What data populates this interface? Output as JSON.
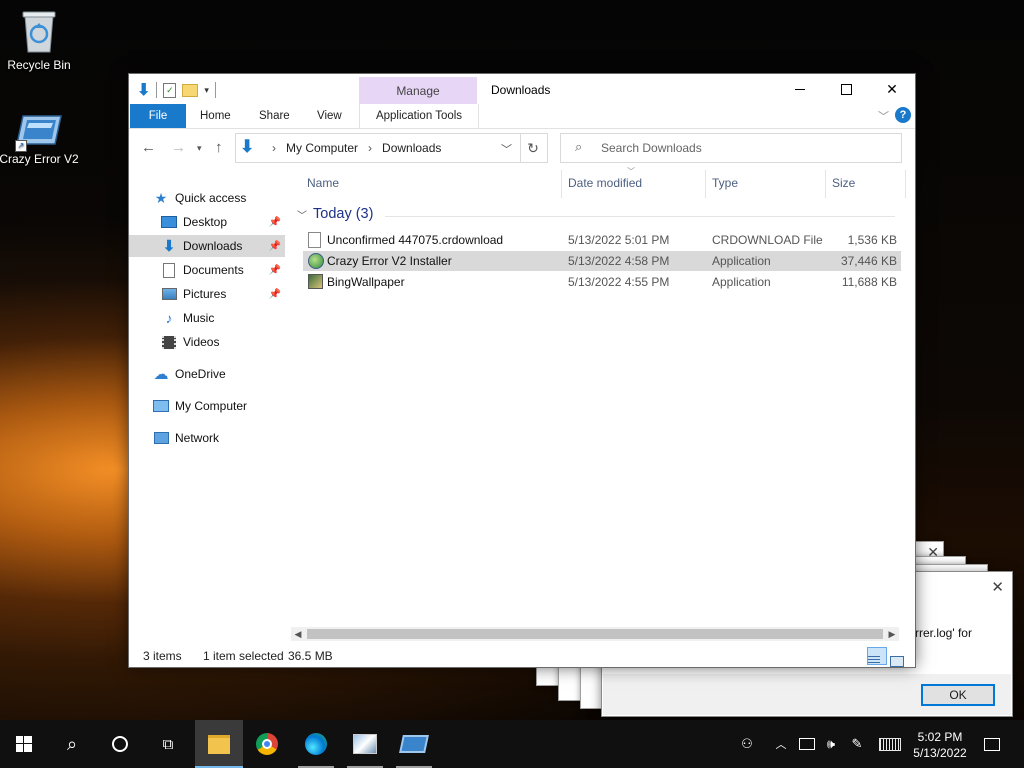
{
  "desktop": {
    "icons": [
      {
        "label": "Recycle Bin"
      },
      {
        "label": "Crazy Error V2"
      }
    ]
  },
  "explorer": {
    "title": "Downloads",
    "ribbon": {
      "contextual_group": "Manage",
      "tabs": [
        "File",
        "Home",
        "Share",
        "View",
        "Application Tools"
      ]
    },
    "address": {
      "crumbs": [
        "My Computer",
        "Downloads"
      ]
    },
    "search": {
      "placeholder": "Search Downloads"
    },
    "nav": {
      "items": [
        {
          "label": "Quick access"
        },
        {
          "label": "Desktop"
        },
        {
          "label": "Downloads"
        },
        {
          "label": "Documents"
        },
        {
          "label": "Pictures"
        },
        {
          "label": "Music"
        },
        {
          "label": "Videos"
        },
        {
          "label": "OneDrive"
        },
        {
          "label": "My Computer"
        },
        {
          "label": "Network"
        }
      ]
    },
    "columns": [
      "Name",
      "Date modified",
      "Type",
      "Size"
    ],
    "group": "Today (3)",
    "files": [
      {
        "name": "Unconfirmed 447075.crdownload",
        "date": "5/13/2022 5:01 PM",
        "type": "CRDOWNLOAD File",
        "size": "1,536 KB"
      },
      {
        "name": "Crazy Error V2 Installer",
        "date": "5/13/2022 4:58 PM",
        "type": "Application",
        "size": "37,446 KB"
      },
      {
        "name": "BingWallpaper",
        "date": "5/13/2022 4:55 PM",
        "type": "Application",
        "size": "11,688 KB"
      }
    ],
    "status": {
      "items": "3 items",
      "selected": "1 item selected",
      "size": "36.5 MB"
    }
  },
  "dialog": {
    "message": "rrer.log' for",
    "ok": "OK"
  },
  "taskbar": {
    "time": "5:02 PM",
    "date": "5/13/2022"
  },
  "colors": {
    "accent": "#1979ca",
    "manage_tab": "#e8d6f6",
    "taskbar": "#101010"
  }
}
